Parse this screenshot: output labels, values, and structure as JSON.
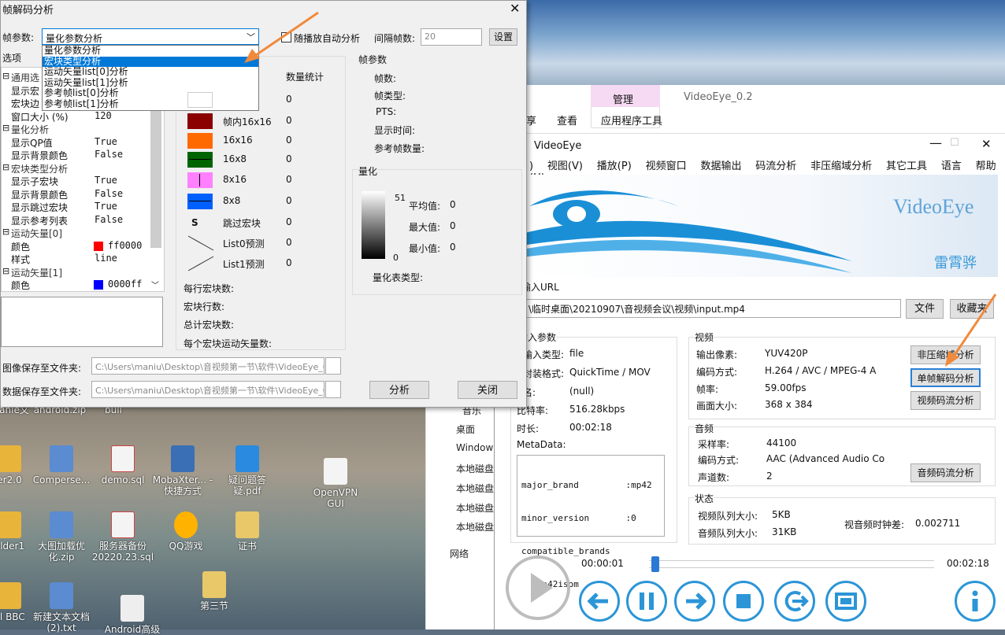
{
  "desktop": {
    "icons": [
      {
        "label": "anie文"
      },
      {
        "label": "android.zip"
      },
      {
        "label": "buil"
      },
      {
        "label": "er2.0"
      },
      {
        "label": "Comperse..."
      },
      {
        "label": "demo.sql"
      },
      {
        "label": "MobaXter... - 快捷方式"
      },
      {
        "label": "疑问题答疑.pdf"
      },
      {
        "label": "OpenVPN GUI"
      },
      {
        "label": "older1"
      },
      {
        "label": "大图加载优化.zip"
      },
      {
        "label": "服务器备份20220.23.sql"
      },
      {
        "label": "QQ游戏"
      },
      {
        "label": "证书"
      },
      {
        "label": "ql BBC"
      },
      {
        "label": "新建文本文档(2).txt"
      },
      {
        "label": "Android高级"
      },
      {
        "label": "第三节"
      }
    ]
  },
  "explorer": {
    "items": [
      "音乐",
      "桌面",
      "Window",
      "本地磁盘",
      "本地磁盘",
      "本地磁盘",
      "本地磁盘",
      "网络"
    ]
  },
  "ribbon": {
    "tab_manage": "管理",
    "app_title": "VideoEye_0.2",
    "tab_view": "查看",
    "tab_app_tools": "应用程序工具",
    "left_tab": "享"
  },
  "videoeye": {
    "title": "VideoEye",
    "menu": [
      "视图(V)",
      "播放(P)",
      "视频窗口",
      "数据输出",
      "码流分析",
      "非压缩域分析",
      "其它工具",
      "语言",
      "帮助(H)"
    ],
    "menu_first": ")",
    "logo_text": "VideoEye",
    "logo_author": "雷霄骅",
    "url_label": "输入URL",
    "url_value": "\\临时桌面\\20210907\\音视频会议\\视频\\input.mp4",
    "file_button": "文件",
    "fav_button": "收藏夹",
    "input_group": "输入参数",
    "input_type_label": "输入类型:",
    "input_type": "file",
    "format_label": "封装格式:",
    "format": "QuickTime / MOV",
    "name_label": "名:",
    "name": "(null)",
    "bitrate_label": "比特率:",
    "bitrate": "516.28kbps",
    "duration_label": "时长:",
    "duration": "00:02:18",
    "metadata_label": "MetaData:",
    "metadata_lines": [
      "major_brand         :mp42",
      "minor_version       :0",
      "compatible_brands",
      "  :mp42isom"
    ],
    "video_group": "视频",
    "out_pix_label": "输出像素:",
    "out_pix": "YUV420P",
    "vcodec_label": "编码方式:",
    "vcodec": "H.264 / AVC / MPEG-4 A",
    "fps_label": "帧率:",
    "fps": "59.00fps",
    "size_label": "画面大小:",
    "size": "368 x 384",
    "btn_raw": "非压缩域分析",
    "btn_frame": "单帧解码分析",
    "btn_vstream": "视频码流分析",
    "audio_group": "音频",
    "sample_label": "采样率:",
    "sample": "44100",
    "acodec_label": "编码方式:",
    "acodec": "AAC (Advanced Audio Co",
    "channels_label": "声道数:",
    "channels": "2",
    "btn_astream": "音频码流分析",
    "status_group": "状态",
    "vq_label": "视频队列大小:",
    "vq": "5KB",
    "aq_label": "音频队列大小:",
    "aq": "31KB",
    "av_diff_label": "视音频时钟差:",
    "av_diff": "0.002711",
    "time_current": "00:00:01",
    "time_total": "00:02:18",
    "progress_fraction": 0.008
  },
  "dialog": {
    "title": "帧解码分析",
    "param_label": "帧参数:",
    "param_selected": "量化参数分析",
    "dropdown_options": [
      "量化参数分析",
      "宏块类型分析",
      "运动矢量list[0]分析",
      "运动矢量list[1]分析",
      "参考帧list[0]分析",
      "参考帧list[1]分析"
    ],
    "dropdown_highlight_index": 1,
    "auto_analyze_label": "随播放自动分析",
    "interval_label": "间隔帧数:",
    "interval_value": "20",
    "settings_button": "设置",
    "options_label": "选项",
    "tree": [
      {
        "text": "通用选",
        "value": "",
        "expand": "⊟"
      },
      {
        "text": "显示宏",
        "value": ""
      },
      {
        "text": "宏块边",
        "value": ""
      },
      {
        "text": "窗口大小 (%)",
        "value": "120"
      },
      {
        "text": "量化分析",
        "value": "",
        "expand": "⊟"
      },
      {
        "text": "显示QP值",
        "value": "True"
      },
      {
        "text": "显示背景颜色",
        "value": "False"
      },
      {
        "text": "宏块类型分析",
        "value": "",
        "expand": "⊟"
      },
      {
        "text": "显示子宏块",
        "value": "True"
      },
      {
        "text": "显示背景颜色",
        "value": "False"
      },
      {
        "text": "显示跳过宏块",
        "value": "True"
      },
      {
        "text": "显示参考列表",
        "value": "False"
      },
      {
        "text": "运动矢量[0]",
        "value": "",
        "expand": "⊟"
      },
      {
        "text": "颜色",
        "value": "ff0000",
        "swatch": "#ff0000"
      },
      {
        "text": "样式",
        "value": "line"
      },
      {
        "text": "运动矢量[1]",
        "value": "",
        "expand": "⊟"
      },
      {
        "text": "颜色",
        "value": "0000ff",
        "swatch": "#0000ff"
      }
    ],
    "mb_count_header": "数量统计",
    "mb_types": [
      {
        "label": "",
        "count": "0",
        "color": "#ffffff"
      },
      {
        "label": "帧内16x16",
        "count": "0",
        "color": "#8b0000"
      },
      {
        "label": "16x16",
        "count": "0",
        "color": "#ff6a00"
      },
      {
        "label": "16x8",
        "count": "0",
        "color": "#006400"
      },
      {
        "label": "8x16",
        "count": "0",
        "color": "#ff80ff"
      },
      {
        "label": "8x8",
        "count": "0",
        "color": "#0060ff"
      },
      {
        "label": "跳过宏块",
        "count": "0",
        "color": "none",
        "glyph": "S"
      },
      {
        "label": "List0预测",
        "count": "0",
        "color": "none"
      },
      {
        "label": "List1预测",
        "count": "0",
        "color": "none"
      }
    ],
    "mb_per_row_label": "每行宏块数:",
    "mb_rows_label": "宏块行数:",
    "mb_total_label": "总计宏块数:",
    "mv_per_mb_label": "每个宏块运动矢量数:",
    "frame_params_group": "帧参数",
    "frame_no_label": "帧数:",
    "frame_type_label": "帧类型:",
    "pts_label": "PTS:",
    "display_time_label": "显示时间:",
    "ref_count_label": "参考帧数量:",
    "quant_group": "量化",
    "scale_max": "51",
    "scale_min": "0",
    "avg_label": "平均值:",
    "avg": "0",
    "max_label": "最大值:",
    "max": "0",
    "min_label": "最小值:",
    "min": "0",
    "quant_table_label": "量化表类型:",
    "save_image_label": "图像保存至文件夹:",
    "save_image_path": "C:\\Users\\maniu\\Desktop\\音视频第一节\\软件\\VideoEye_0",
    "save_data_label": "数据保存至文件夹:",
    "save_data_path": "C:\\Users\\maniu\\Desktop\\音视频第一节\\软件\\VideoEye_0",
    "analyze_button": "分析",
    "close_button": "关闭"
  },
  "colors": {
    "accent": "#2b95d7",
    "arrow": "#f08a3c",
    "ribbon_tab": "#f6d9f3",
    "highlight": "#0078d7"
  }
}
